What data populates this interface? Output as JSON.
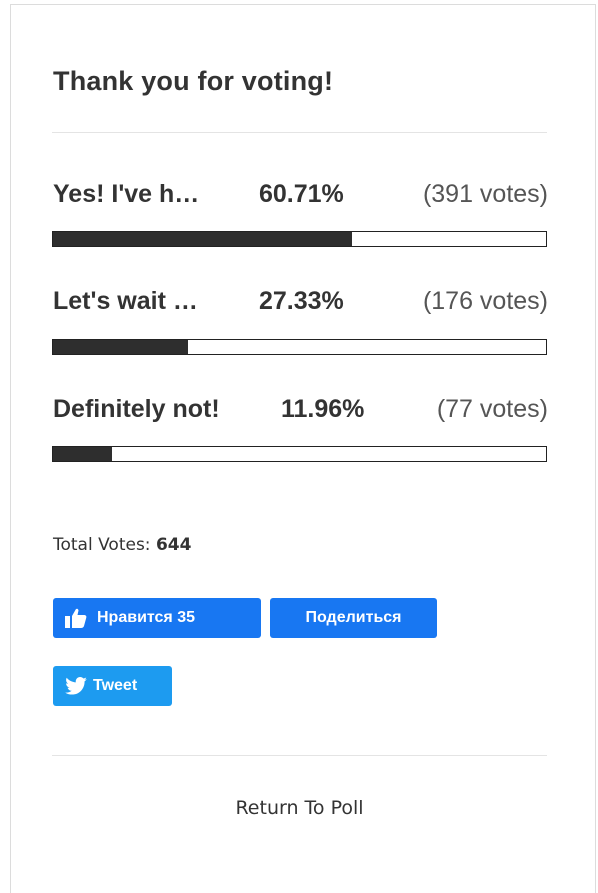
{
  "poll": {
    "title": "Thank you for voting!",
    "answers": [
      {
        "label": "Yes! I've h…",
        "percent_text": "60.71%",
        "votes_text": "(391 votes)",
        "percent": 60.71
      },
      {
        "label": "Let's wait …",
        "percent_text": "27.33%",
        "votes_text": "(176 votes)",
        "percent": 27.33
      },
      {
        "label": "Definitely not!",
        "percent_text": "11.96%",
        "votes_text": "(77 votes)",
        "percent": 11.96
      }
    ],
    "total_label": "Total Votes:",
    "total_value": "644",
    "return_label": "Return To Poll"
  },
  "social": {
    "facebook_like_label": "Нравится 35",
    "facebook_share_label": "Поделиться",
    "tweet_label": "Tweet",
    "facebook_color": "#1877f2",
    "twitter_color": "#1d9bf0",
    "icons": [
      "thumbs-up-icon",
      "twitter-bird-icon"
    ]
  },
  "colors": {
    "bar_fill": "#2e2e2e",
    "bar_border": "#222222",
    "text": "#333333"
  }
}
